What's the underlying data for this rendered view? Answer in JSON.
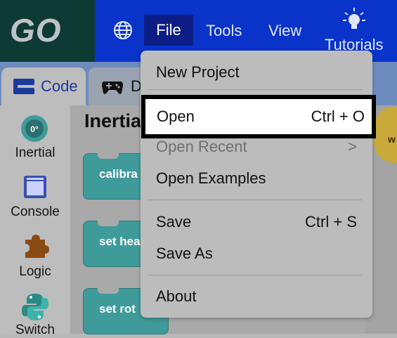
{
  "app": {
    "logo": "GO",
    "menu": {
      "file": "File",
      "tools": "Tools",
      "view": "View",
      "tutorials": "Tutorials"
    }
  },
  "tabs": {
    "code": "Code",
    "devices": "D"
  },
  "palette": {
    "items": [
      {
        "label": "Inertial",
        "icon": "inertial-dial-icon"
      },
      {
        "label": "Console",
        "icon": "console-window-icon"
      },
      {
        "label": "Logic",
        "icon": "puzzle-piece-icon"
      },
      {
        "label": "Switch",
        "icon": "python-icon"
      }
    ]
  },
  "flyout": {
    "title": "Inertia",
    "blocks": [
      "calibra",
      "set hea",
      "set rot"
    ]
  },
  "workspace": {
    "partial_block": "w"
  },
  "file_menu": {
    "items": [
      {
        "label": "New Project",
        "shortcut": ""
      },
      {
        "label": "Open",
        "shortcut": "Ctrl + O"
      },
      {
        "label": "Open Recent",
        "shortcut": ">"
      },
      {
        "label": "Open Examples",
        "shortcut": ""
      },
      {
        "label": "Save",
        "shortcut": "Ctrl + S"
      },
      {
        "label": "Save As",
        "shortcut": ""
      },
      {
        "label": "About",
        "shortcut": ""
      }
    ]
  },
  "colors": {
    "topbar": "#0a34c9",
    "logo_bg": "#0d3b33",
    "block": "#3f9b9a",
    "code_tab_text": "#1c3a9a"
  }
}
